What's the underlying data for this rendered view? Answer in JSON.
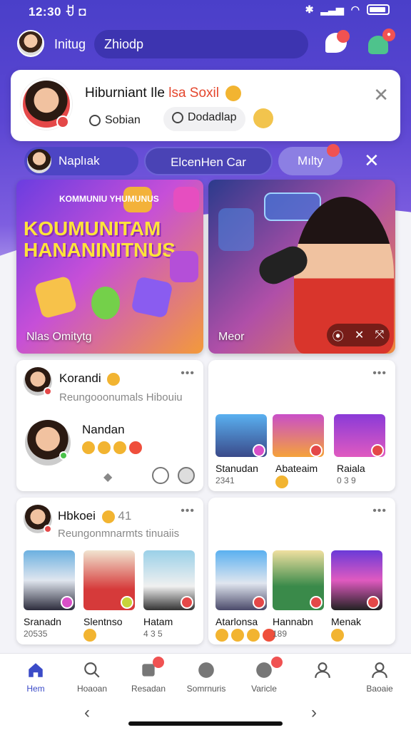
{
  "status": {
    "time": "12:30 ꀀ ◘",
    "icons": [
      "bluetooth-icon",
      "signal-icon",
      "wifi-icon",
      "battery-icon"
    ]
  },
  "topbar": {
    "username": "Initug",
    "search_text": "Zhiodp"
  },
  "group": {
    "title_main": "Hiburniant Ile",
    "title_accent": "lsa Soxil",
    "chip1": "Sobian",
    "chip2": "Dodadlap"
  },
  "tabs": {
    "user": "Naplıak",
    "middle": "ElcenHen Car",
    "right": "Mılty"
  },
  "hero": {
    "left_title": "KOUMUNITAM HANANINITNUS",
    "left_sub": "KOMMUNIU YHUMUNUS",
    "left_label": "Nlas Omitytg",
    "right_label": "Meor"
  },
  "card1": {
    "name": "Korandi",
    "sub": "Reungooonumals Hibouiu",
    "nested_name": "Nandan"
  },
  "card2": {
    "thumbs": [
      {
        "name": "Stanudan",
        "sub": "2341"
      },
      {
        "name": "Abateaim",
        "sub": ""
      },
      {
        "name": "Raiala",
        "sub": "0 3 9"
      }
    ]
  },
  "card3": {
    "name": "Hbkoei",
    "suffix": "41",
    "sub": "Reungonmnarmts tinuaiis",
    "thumbs": [
      {
        "name": "Sranadn",
        "sub": "20535"
      },
      {
        "name": "Slentnso",
        "sub": ""
      },
      {
        "name": "Hatam",
        "sub": "4 3 5"
      }
    ]
  },
  "card4": {
    "thumbs": [
      {
        "name": "Atarlonsa",
        "sub": ""
      },
      {
        "name": "Hannabn",
        "sub": "189"
      },
      {
        "name": "Menak",
        "sub": ""
      }
    ]
  },
  "nav": [
    {
      "label": "Hem",
      "icon": "home-icon"
    },
    {
      "label": "Hoaoan",
      "icon": "search-icon"
    },
    {
      "label": "Resadan",
      "icon": "message-icon"
    },
    {
      "label": "Somrnuris",
      "icon": "community-icon"
    },
    {
      "label": "Varicle",
      "icon": "game-icon"
    },
    {
      "label": "",
      "icon": "profile-icon"
    },
    {
      "label": "Baoaie",
      "icon": "user-icon"
    }
  ],
  "colors": {
    "accent": "#4a3fc9",
    "badge": "#f05252",
    "active_nav": "#3b4bc8"
  }
}
